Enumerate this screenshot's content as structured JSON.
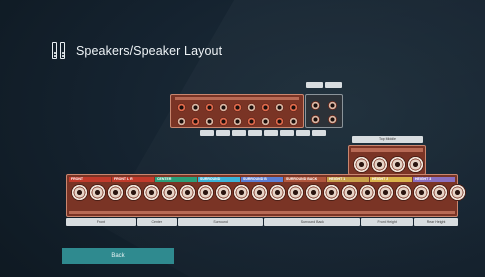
{
  "header": {
    "title": "Speakers/Speaker Layout",
    "icon": "speaker-pair-icon"
  },
  "diagram": {
    "top_middle_label": "Top Middle",
    "main_segments": [
      {
        "label": "FRONT",
        "color": "#c33a2b"
      },
      {
        "label": "FRONT L R",
        "color": "#c33a2b"
      },
      {
        "label": "CENTER",
        "color": "#2aa07a"
      },
      {
        "label": "SURROUND",
        "color": "#3ab3d8"
      },
      {
        "label": "SURROUND B",
        "color": "#5a7fd6"
      },
      {
        "label": "SURROUND BACK",
        "color": "#b3583e"
      },
      {
        "label": "HEIGHT 1",
        "color": "#c9a14a"
      },
      {
        "label": "HEIGHT 2",
        "color": "#d9b34a"
      },
      {
        "label": "HEIGHT 3",
        "color": "#8a6fc0"
      }
    ],
    "channel_tags": [
      "Front",
      "Center",
      "Surround",
      "Surround Back",
      "Front Height",
      "Rear Height"
    ]
  },
  "footer": {
    "back_label": "Back"
  },
  "colors": {
    "accent": "#2f8a8f",
    "panel": "#7a3425",
    "background": "#0f1a22"
  }
}
